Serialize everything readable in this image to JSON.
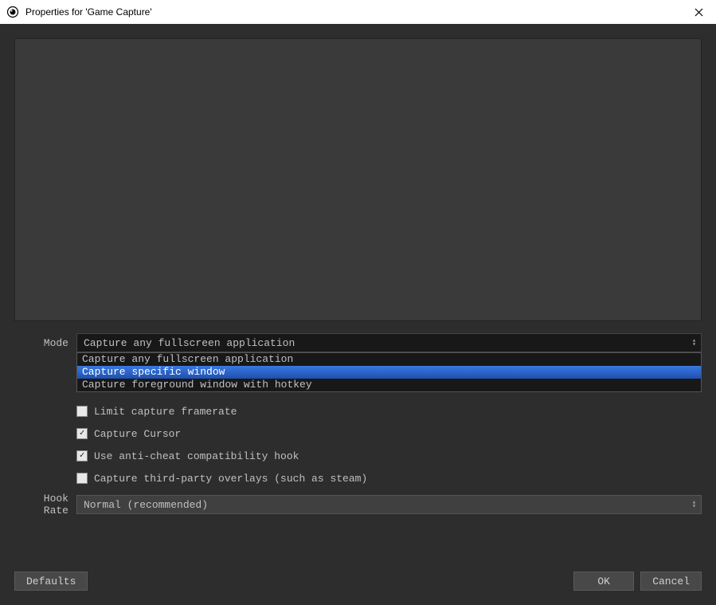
{
  "titlebar": {
    "title": "Properties for 'Game Capture'"
  },
  "form": {
    "mode": {
      "label": "Mode",
      "selected": "Capture any fullscreen application",
      "options": [
        "Capture any fullscreen application",
        "Capture specific window",
        "Capture foreground window with hotkey"
      ],
      "highlighted_index": 1
    },
    "checkboxes": [
      {
        "label": "Limit capture framerate",
        "checked": false
      },
      {
        "label": "Capture Cursor",
        "checked": true
      },
      {
        "label": "Use anti-cheat compatibility hook",
        "checked": true
      },
      {
        "label": "Capture third-party overlays (such as steam)",
        "checked": false
      }
    ],
    "hook_rate": {
      "label": "Hook Rate",
      "selected": "Normal (recommended)"
    }
  },
  "buttons": {
    "defaults": "Defaults",
    "ok": "OK",
    "cancel": "Cancel"
  }
}
